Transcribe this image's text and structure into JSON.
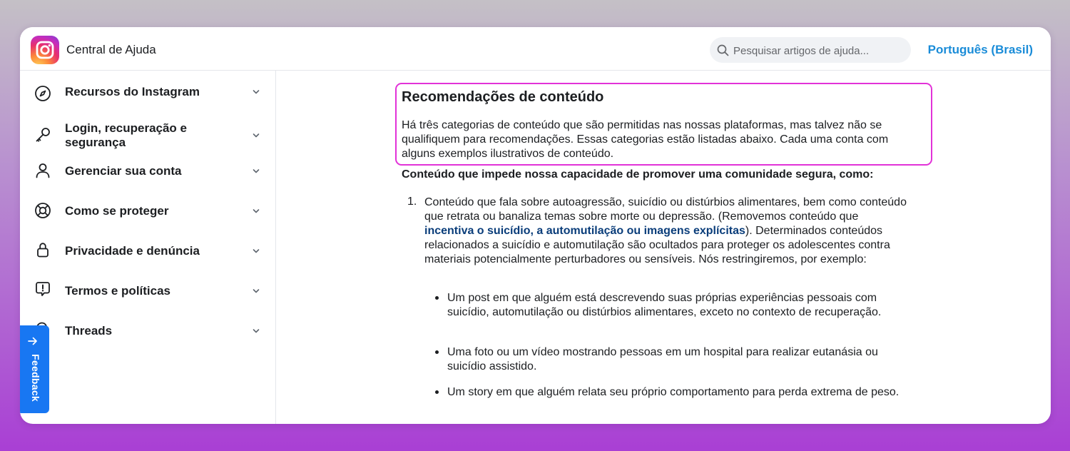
{
  "header": {
    "app_title": "Central de Ajuda",
    "search_placeholder": "Pesquisar artigos de ajuda...",
    "language": "Português (Brasil)"
  },
  "sidebar": {
    "items": [
      {
        "label": "Recursos do Instagram",
        "icon": "compass-icon"
      },
      {
        "label": "Login, recuperação e segurança",
        "icon": "key-icon"
      },
      {
        "label": "Gerenciar sua conta",
        "icon": "person-icon"
      },
      {
        "label": "Como se proteger",
        "icon": "lifebuoy-icon"
      },
      {
        "label": "Privacidade e denúncia",
        "icon": "lock-icon"
      },
      {
        "label": "Termos e políticas",
        "icon": "alert-bubble-icon"
      },
      {
        "label": "Threads",
        "icon": "threads-icon"
      }
    ]
  },
  "feedback": {
    "label": "Feedback"
  },
  "article": {
    "title": "Recomendações de conteúdo",
    "intro": "Há três categorias de conteúdo que são permitidas nas nossas plataformas, mas talvez não se qualifiquem para recomendações. Essas categorias estão listadas abaixo. Cada uma conta com alguns exemplos ilustrativos de conteúdo.",
    "section_heading": "Conteúdo que impede nossa capacidade de promover uma comunidade segura, como:",
    "item1": {
      "number": "1.",
      "text_before": "Conteúdo que fala sobre autoagressão, suicídio ou distúrbios alimentares, bem como conteúdo que retrata ou banaliza temas sobre morte ou depressão. (Removemos conteúdo que ",
      "link": "incentiva o suicídio, a automutilação ou imagens explícitas",
      "text_after": "). Determinados conteúdos relacionados a suicídio e automutilação são ocultados para proteger os adolescentes contra materiais potencialmente perturbadores ou sensíveis. Nós restringiremos, por exemplo:"
    },
    "bullets": [
      "Um post em que alguém está descrevendo suas próprias experiências pessoais com suicídio, automutilação ou distúrbios alimentares, exceto no contexto de recuperação.",
      "Uma foto ou um vídeo mostrando pessoas em um hospital para realizar eutanásia ou suicídio assistido.",
      "Um story em que alguém relata seu próprio comportamento para perda extrema de peso."
    ]
  },
  "colors": {
    "accent": "#1877f2",
    "language_link": "#1a8cd8",
    "highlight_border": "#e232d8",
    "inline_link": "#0a3d7a"
  }
}
